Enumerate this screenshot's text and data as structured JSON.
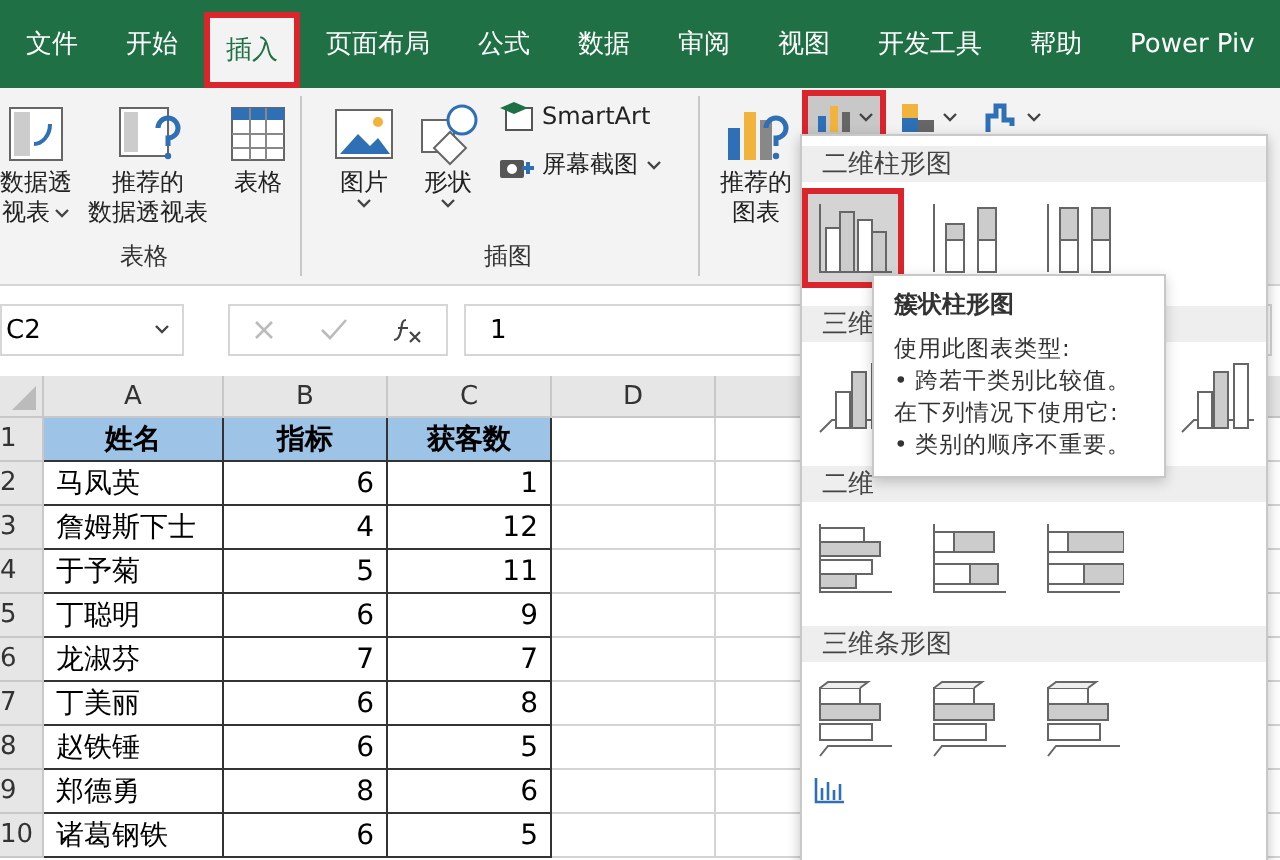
{
  "tabs": [
    {
      "label": "文件",
      "selected": false,
      "highlighted": false
    },
    {
      "label": "开始",
      "selected": false,
      "highlighted": false
    },
    {
      "label": "插入",
      "selected": true,
      "highlighted": true
    },
    {
      "label": "页面布局",
      "selected": false,
      "highlighted": false
    },
    {
      "label": "公式",
      "selected": false,
      "highlighted": false
    },
    {
      "label": "数据",
      "selected": false,
      "highlighted": false
    },
    {
      "label": "审阅",
      "selected": false,
      "highlighted": false
    },
    {
      "label": "视图",
      "selected": false,
      "highlighted": false
    },
    {
      "label": "开发工具",
      "selected": false,
      "highlighted": false
    },
    {
      "label": "帮助",
      "selected": false,
      "highlighted": false
    },
    {
      "label": "Power Piv",
      "selected": false,
      "highlighted": false
    }
  ],
  "ribbon": {
    "groups": [
      {
        "label": "表格",
        "buttons": [
          {
            "kind": "pivot",
            "lines": [
              "数据透",
              "视表"
            ],
            "dropdown": true
          },
          {
            "kind": "recommended-pivot",
            "lines": [
              "推荐的",
              "数据透视表"
            ],
            "dropdown": false
          },
          {
            "kind": "table",
            "lines": [
              "表格"
            ],
            "dropdown": false
          }
        ]
      },
      {
        "label": "插图",
        "buttons": [
          {
            "kind": "picture",
            "lines": [
              "图片"
            ],
            "dropdown": true
          },
          {
            "kind": "shapes",
            "lines": [
              "形状"
            ],
            "dropdown": true
          }
        ],
        "small_buttons": [
          {
            "kind": "smartart",
            "label": "SmartArt",
            "dropdown": false
          },
          {
            "kind": "screenshot",
            "label": "屏幕截图",
            "dropdown": true
          }
        ]
      },
      {
        "buttons": [
          {
            "kind": "recommended-chart",
            "lines": [
              "推荐的",
              "图表"
            ],
            "dropdown": false
          }
        ],
        "chart_buttons": [
          {
            "kind": "column",
            "highlighted": true
          },
          {
            "kind": "hierarchy",
            "highlighted": false
          },
          {
            "kind": "waterfall",
            "highlighted": false
          }
        ]
      }
    ]
  },
  "formula_bar": {
    "name_box": "C2",
    "value": "1"
  },
  "sheet": {
    "columns": [
      "A",
      "B",
      "C",
      "D"
    ],
    "rows": [
      {
        "number": "1",
        "cells": [
          "姓名",
          "指标",
          "获客数"
        ],
        "header": true
      },
      {
        "number": "2",
        "cells": [
          "马凤英",
          "6",
          "1"
        ],
        "header": false
      },
      {
        "number": "3",
        "cells": [
          "詹姆斯下士",
          "4",
          "12"
        ],
        "header": false
      },
      {
        "number": "4",
        "cells": [
          "于予菊",
          "5",
          "11"
        ],
        "header": false
      },
      {
        "number": "5",
        "cells": [
          "丁聪明",
          "6",
          "9"
        ],
        "header": false
      },
      {
        "number": "6",
        "cells": [
          "龙淑芬",
          "7",
          "7"
        ],
        "header": false
      },
      {
        "number": "7",
        "cells": [
          "丁美丽",
          "6",
          "8"
        ],
        "header": false
      },
      {
        "number": "8",
        "cells": [
          "赵铁锤",
          "6",
          "5"
        ],
        "header": false
      },
      {
        "number": "9",
        "cells": [
          "郑德勇",
          "8",
          "6"
        ],
        "header": false
      },
      {
        "number": "10",
        "cells": [
          "诸葛钢铁",
          "6",
          "5"
        ],
        "header": false
      }
    ]
  },
  "chart_menu": {
    "sections": [
      {
        "title": "二维柱形图",
        "kind": "column2d",
        "options": [
          {
            "highlighted": true
          },
          {
            "highlighted": false
          },
          {
            "highlighted": false
          }
        ]
      },
      {
        "title": "三维",
        "kind": "column3d",
        "options": [
          {
            "highlighted": false
          },
          {
            "highlighted": false
          }
        ]
      },
      {
        "title": "二维",
        "kind": "bar2d",
        "options": [
          {
            "highlighted": false
          },
          {
            "highlighted": false
          },
          {
            "highlighted": false
          }
        ]
      },
      {
        "title": "三维条形图",
        "kind": "bar3d",
        "options": [
          {
            "highlighted": false
          },
          {
            "highlighted": false
          },
          {
            "highlighted": false
          }
        ]
      }
    ]
  },
  "tooltip": {
    "title": "簇状柱形图",
    "lines": [
      "使用此图表类型:",
      "• 跨若干类别比较值。",
      "在下列情况下使用它:",
      "• 类别的顺序不重要。"
    ]
  }
}
